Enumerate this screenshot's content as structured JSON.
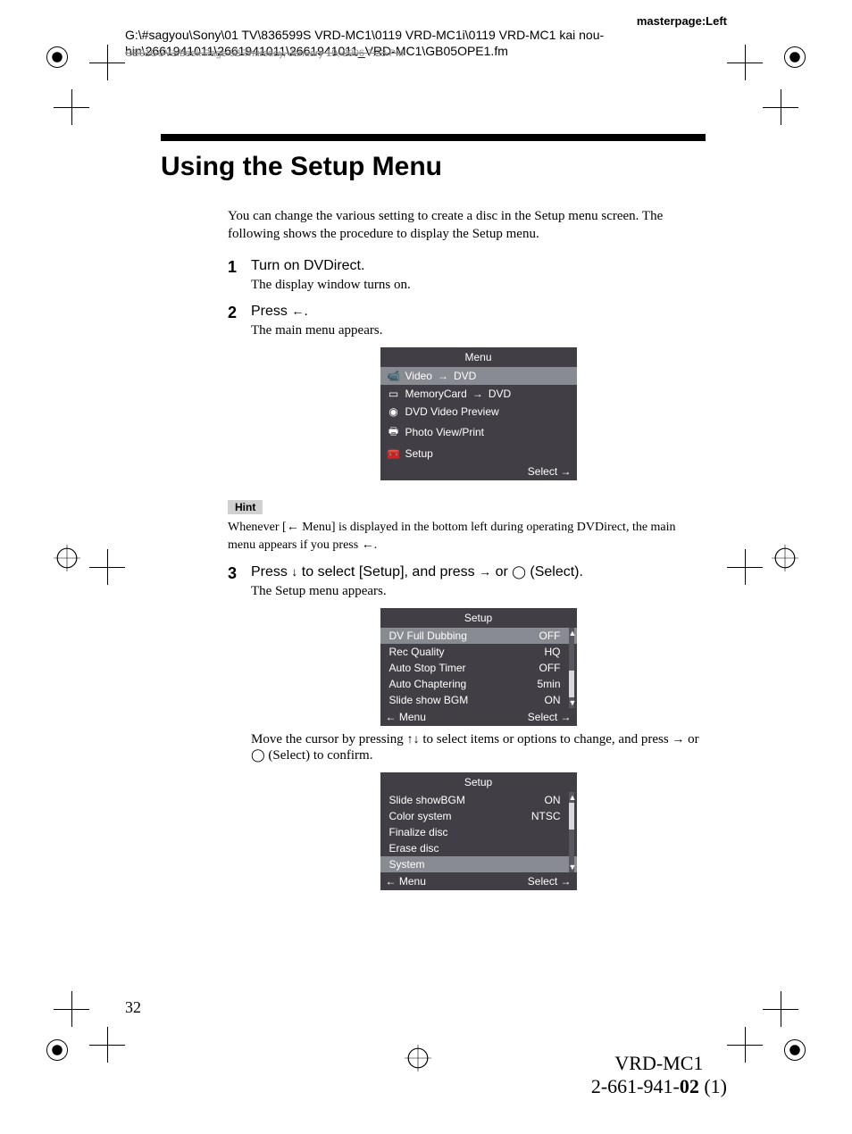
{
  "header": {
    "masterpage": "masterpage:Left",
    "filepath_line1": "G:\\#sagyou\\Sony\\01 TV\\836599S VRD-MC1\\0119 VRD-MC1i\\0119 VRD-MC1 kai nou-",
    "filepath_line2": "hin\\2661941011\\2661941011\\2661941011_VRD-MC1\\GB05OPE1.fm",
    "ghost_text": "GB01COV1.book  Page 32  Thursday, January 19, 2006  7:23 PM"
  },
  "title": "Using the Setup Menu",
  "intro": "You can change the various setting to create a disc in the Setup menu screen. The following shows the procedure to display the Setup menu.",
  "steps": {
    "s1": {
      "num": "1",
      "head": "Turn on DVDirect.",
      "desc": "The display window turns on."
    },
    "s2": {
      "num": "2",
      "head_prefix": "Press ",
      "head_suffix": ".",
      "desc": "The main menu appears."
    },
    "s3": {
      "num": "3",
      "head_prefix": "Press ",
      "head_mid1": " to select [Setup], and press ",
      "head_mid2": " or ",
      "head_suffix": " (Select).",
      "desc": "The Setup menu appears.",
      "after1_prefix": "Move the cursor by pressing ",
      "after1_mid": " to select items or options to change, and press ",
      "after1_mid2": " or ",
      "after1_suffix": " (Select) to confirm."
    }
  },
  "hint": {
    "label": "Hint",
    "text_prefix": "Whenever [",
    "text_mid": " Menu] is displayed in the bottom left during operating DVDirect, the main menu appears if you press ",
    "text_suffix": "."
  },
  "menu1": {
    "title": "Menu",
    "rows": [
      {
        "label_a": "Video",
        "arrow": true,
        "label_b": "DVD",
        "selected": true,
        "icon": "camcorder"
      },
      {
        "label_a": "MemoryCard",
        "arrow": true,
        "label_b": "DVD",
        "selected": false,
        "icon": "card"
      },
      {
        "label_a": "DVD Video Preview",
        "arrow": false,
        "label_b": "",
        "selected": false,
        "icon": "disc"
      },
      {
        "label_a": "Photo View/Print",
        "arrow": false,
        "label_b": "",
        "selected": false,
        "icon": "printer"
      },
      {
        "label_a": "Setup",
        "arrow": false,
        "label_b": "",
        "selected": false,
        "icon": "toolbox"
      }
    ],
    "footer_right": "Select"
  },
  "menu2": {
    "title": "Setup",
    "rows": [
      {
        "label": "DV Full Dubbing",
        "value": "OFF",
        "selected": true
      },
      {
        "label": "Rec Quality",
        "value": "HQ",
        "selected": false
      },
      {
        "label": "Auto Stop Timer",
        "value": "OFF",
        "selected": false
      },
      {
        "label": "Auto Chaptering",
        "value": "5min",
        "selected": false
      },
      {
        "label": "Slide show BGM",
        "value": "ON",
        "selected": false
      }
    ],
    "footer_left": "Menu",
    "footer_right": "Select"
  },
  "menu3": {
    "title": "Setup",
    "rows": [
      {
        "label": "Slide showBGM",
        "value": "ON",
        "selected": false
      },
      {
        "label": "Color system",
        "value": "NTSC",
        "selected": false
      },
      {
        "label": "Finalize disc",
        "value": "",
        "selected": false
      },
      {
        "label": "Erase disc",
        "value": "",
        "selected": false
      },
      {
        "label": "System",
        "value": "",
        "selected": true
      }
    ],
    "footer_left": "Menu",
    "footer_right": "Select"
  },
  "page_number": "32",
  "footer": {
    "model": "VRD-MC1",
    "docnum_prefix": "2-661-941-",
    "docnum_bold": "02",
    "docnum_suffix": " (1)"
  },
  "glyphs": {
    "left_arrow": "←",
    "right_arrow": "→",
    "down_arrow": "↓",
    "up_arrow": "↑",
    "updown": "↑↓",
    "circle": "◯",
    "small_right": "→",
    "footer_left_arrow": "←",
    "footer_right_arrow": "→"
  }
}
